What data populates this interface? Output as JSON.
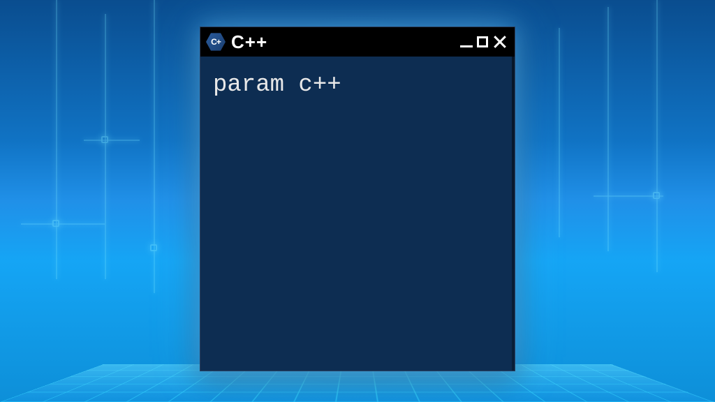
{
  "window": {
    "title": "C++",
    "icon_name": "cpp-hex-icon"
  },
  "terminal": {
    "content": "param c++"
  },
  "colors": {
    "terminal_bg": "#0d2d52",
    "titlebar_bg": "#000000",
    "text": "#e8e8e8",
    "glow": "#50b4ff"
  }
}
